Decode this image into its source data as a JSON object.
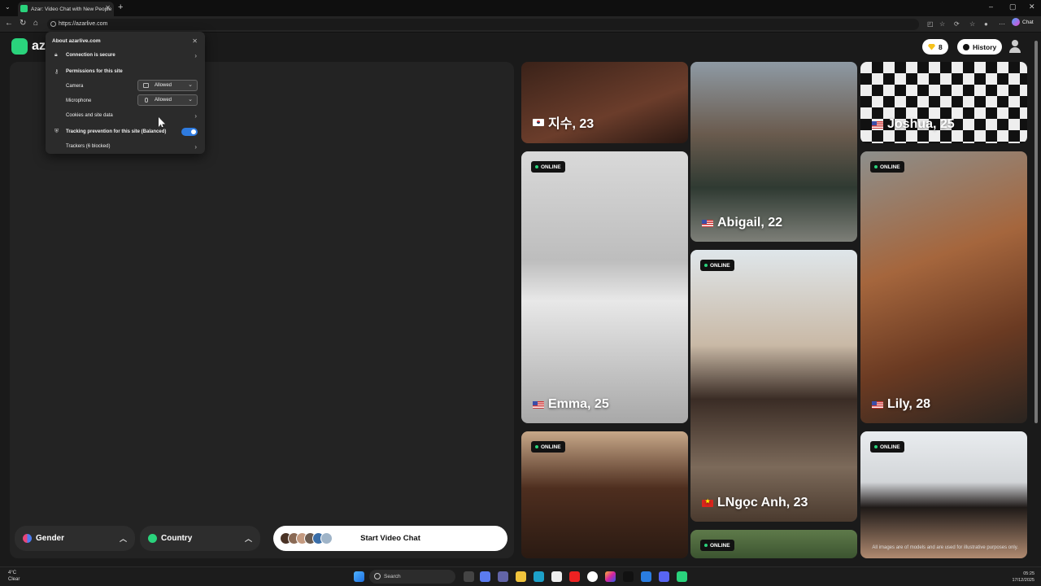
{
  "browser": {
    "tab_title": "Azar: Video Chat with New People",
    "url": "https://azarlive.com",
    "copilot_label": "Chat"
  },
  "site_info": {
    "title": "About azarlive.com",
    "connection": "Connection is secure",
    "permissions_title": "Permissions for this site",
    "camera_label": "Camera",
    "camera_value": "Allowed",
    "microphone_label": "Microphone",
    "microphone_value": "Allowed",
    "cookies": "Cookies and site data",
    "tracking": "Tracking prevention for this site (Balanced)",
    "tracking_enabled": true,
    "trackers": "Trackers (6 blocked)"
  },
  "header": {
    "logo_text": "az",
    "gems": "8",
    "history_label": "History"
  },
  "controls": {
    "gender_label": "Gender",
    "country_label": "Country",
    "start_label": "Start Video Chat"
  },
  "profiles": [
    {
      "name": "지수, 23",
      "flag": "KR",
      "online": false
    },
    {
      "name": "Abigail, 22",
      "flag": "US",
      "online": false
    },
    {
      "name": "Joshua, 25",
      "flag": "US",
      "online": false
    },
    {
      "name": "Emma, 25",
      "flag": "US",
      "online": true
    },
    {
      "name": "Lily, 28",
      "flag": "US",
      "online": true
    },
    {
      "name": "LNgọc Anh, 23",
      "flag": "VN",
      "online": true
    },
    {
      "name": "",
      "flag": "",
      "online": true
    },
    {
      "name": "",
      "flag": "",
      "online": true
    },
    {
      "name": "",
      "flag": "",
      "online": true
    }
  ],
  "online_label": "ONLINE",
  "disclaimer": "All images are of models and are used for illustrative purposes only.",
  "taskbar": {
    "weather_temp": "4°C",
    "weather_desc": "Clear",
    "search_placeholder": "Search",
    "time": "05:25",
    "date": "17/12/2025"
  },
  "colors": {
    "brand": "#2ad37c",
    "toggle": "#2e7be0"
  }
}
